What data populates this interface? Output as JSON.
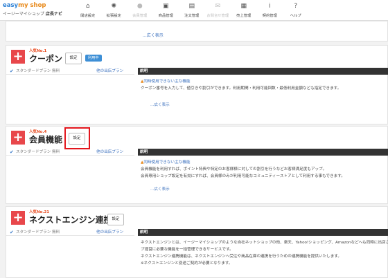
{
  "header": {
    "logo_part1": "easy",
    "logo_part2": "my shop",
    "logo_sub": "イージーマイショップ",
    "logo_sub2": "店長ナビ",
    "nav": [
      {
        "label": "開店設定",
        "icon": "home-icon",
        "glyph": "⌂",
        "disabled": false
      },
      {
        "label": "拡張設定",
        "icon": "gear-icon",
        "glyph": "✺",
        "disabled": false
      },
      {
        "label": "会員管理",
        "icon": "person-icon",
        "glyph": "●",
        "disabled": true
      },
      {
        "label": "商品管理",
        "icon": "gift-icon",
        "glyph": "▣",
        "disabled": false
      },
      {
        "label": "注文管理",
        "icon": "document-icon",
        "glyph": "▤",
        "disabled": false
      },
      {
        "label": "お問合せ管理",
        "icon": "mail-icon",
        "glyph": "✉",
        "disabled": true
      },
      {
        "label": "売上管理",
        "icon": "calculator-icon",
        "glyph": "▦",
        "disabled": false
      },
      {
        "label": "契約管理",
        "icon": "info-icon",
        "glyph": "i",
        "disabled": false
      },
      {
        "label": "ヘルプ",
        "icon": "help-icon",
        "glyph": "?",
        "disabled": false
      }
    ]
  },
  "more_label": "...広く表示",
  "cards": [
    {
      "rank": "人気No.1",
      "title": "クーポン",
      "setting_label": "設定",
      "status_badge": "利用中",
      "plan": {
        "name": "スタンダードプラン",
        "fee": "無料",
        "link": "他の出店プラン"
      },
      "desc_header": "説明",
      "notice": "同時使用できない主な機能",
      "lines": [
        "クーポン番号を入力して、値引きや割引ができます。利用期間・利用可能回数・最低利用金額なども指定できます。"
      ],
      "more": "...広く表示"
    },
    {
      "rank": "人気No.4",
      "title": "会員機能",
      "setting_label": "設定",
      "plan": {
        "name": "スタンダードプラン",
        "fee": "無料",
        "link": "他の出店プラン"
      },
      "desc_header": "説明",
      "notice": "同時使用できない主な機能",
      "lines": [
        "会員機能を利用すれば、ポイント特典や特定のお客様様に対しての割引を行うなどお客様満足度もアップ。",
        "会員専用ショップ設定を有効にすれば、会員様のみが利用可能なコミュニティーストアとして利用する事もできます。"
      ],
      "more": "...広く表示"
    },
    {
      "rank": "人気No.21",
      "title": "ネクストエンジン連携",
      "setting_label": "設定",
      "plan": {
        "name": "スタンダードプラン",
        "fee": "無料",
        "link": "他の出店プラン"
      },
      "desc_header": "説明",
      "lines": [
        "ネクストエンジンとは、イージーマイショップのような自社ネットショップの他、楽天、Yahoo!ショッピング、Amazonなどへも同時に出店さ",
        "プ運営に必要な機能を一括管理できるサービスです。",
        "ネクストエンジン連携機能は、ネクストエンジンへ受注や商品在庫の連携を行うための連携機能を提供いたします。",
        "※ネクストエンジンと別途ご契約が必要となります。"
      ]
    }
  ]
}
